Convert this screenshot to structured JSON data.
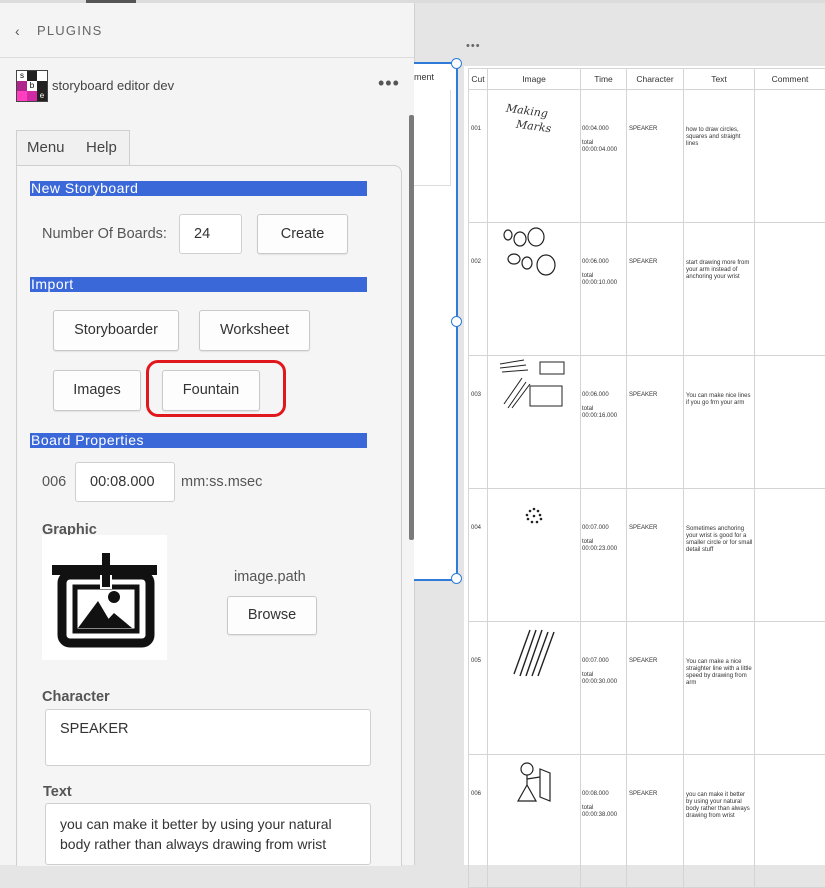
{
  "plugins_header": {
    "back": "‹",
    "title": "PLUGINS"
  },
  "plugin": {
    "name": "storyboard editor dev",
    "more": "•••",
    "logo_letters": [
      "s",
      "b",
      "e"
    ]
  },
  "menu_tabs": [
    "Menu",
    "Help"
  ],
  "new_storyboard": {
    "heading": "New Storyboard",
    "boards_label": "Number Of Boards:",
    "boards_value": "24",
    "create_label": "Create"
  },
  "import": {
    "heading": "Import",
    "buttons": [
      "Storyboarder",
      "Worksheet",
      "Images",
      "Fountain"
    ]
  },
  "board_properties": {
    "heading": "Board Properties",
    "board_number": "006",
    "duration": "00:08.000",
    "duration_format": "mm:ss.msec",
    "graphic_label": "Graphic",
    "image_path": "image.path",
    "browse_label": "Browse",
    "character_label": "Character",
    "character_value": "SPEAKER",
    "text_label": "Text",
    "text_value": "you can make it better by using your natural body rather than always drawing from wrist"
  },
  "canvas": {
    "left_frame_header": "ment",
    "dots": "•••"
  },
  "sheet": {
    "columns": [
      "Cut",
      "Image",
      "Time",
      "Character",
      "Text",
      "Comment"
    ],
    "rows": [
      {
        "cut": "001",
        "time": "00:04.000",
        "total_label": "total",
        "total": "00:00:04.000",
        "character": "SPEAKER",
        "text": "how to draw circles, squares and straight lines",
        "comment": ""
      },
      {
        "cut": "002",
        "time": "00:06.000",
        "total_label": "total",
        "total": "00:00:10.000",
        "character": "SPEAKER",
        "text": "start drawing more from your arm instead of anchoring your wrist",
        "comment": ""
      },
      {
        "cut": "003",
        "time": "00:06.000",
        "total_label": "total",
        "total": "00:00:16.000",
        "character": "SPEAKER",
        "text": "You can make nice lines if you go frm your arm",
        "comment": ""
      },
      {
        "cut": "004",
        "time": "00:07.000",
        "total_label": "total",
        "total": "00:00:23.000",
        "character": "SPEAKER",
        "text": "Sometimes anchoring your wrist is good for a smaller circle or for small detail stuff",
        "comment": ""
      },
      {
        "cut": "005",
        "time": "00:07.000",
        "total_label": "total",
        "total": "00:00:30.000",
        "character": "SPEAKER",
        "text": "You can make a nice straighter line with a little speed by drawing from arm",
        "comment": ""
      },
      {
        "cut": "006",
        "time": "00:08.000",
        "total_label": "total",
        "total": "00:00:38.000",
        "character": "SPEAKER",
        "text": "you can make it better by using your natural body rather than always drawing from wrist",
        "comment": ""
      }
    ],
    "sketch_text": [
      "Making",
      "Marks"
    ]
  },
  "colors": {
    "section_bar": "#3b68d8",
    "highlight": "#e0181e",
    "selection": "#2e7bd8"
  }
}
